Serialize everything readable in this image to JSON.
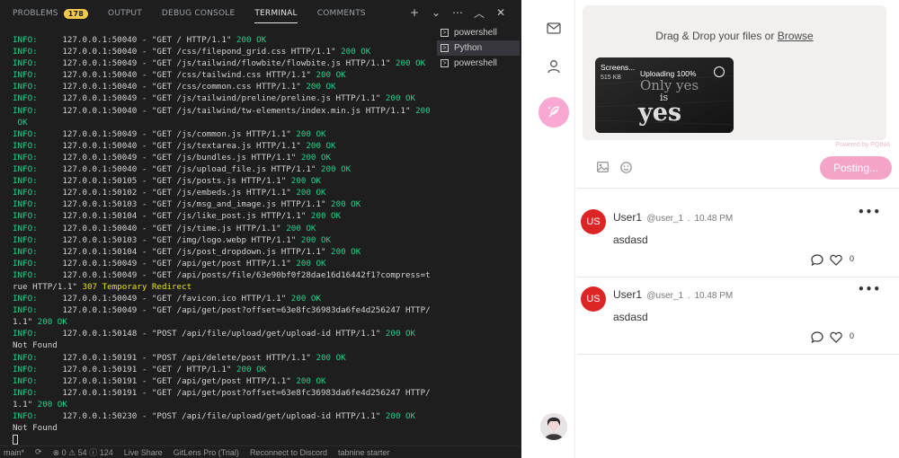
{
  "vscode": {
    "tabs": [
      {
        "label": "PROBLEMS",
        "badge": "178"
      },
      {
        "label": "OUTPUT"
      },
      {
        "label": "DEBUG CONSOLE"
      },
      {
        "label": "TERMINAL"
      },
      {
        "label": "COMMENTS"
      }
    ],
    "active_tab": "TERMINAL",
    "terminal_list": [
      {
        "label": "powershell"
      },
      {
        "label": "Python"
      },
      {
        "label": "powershell"
      }
    ],
    "active_terminal_index": 1,
    "log": [
      {
        "level": "INFO:",
        "text": "     127.0.0.1:50040 - \"GET / HTTP/1.1\" ",
        "status": "200 OK"
      },
      {
        "level": "INFO:",
        "text": "     127.0.0.1:50040 - \"GET /css/filepond_grid.css HTTP/1.1\" ",
        "status": "200 OK"
      },
      {
        "level": "INFO:",
        "text": "     127.0.0.1:50049 - \"GET /js/tailwind/flowbite/flowbite.js HTTP/1.1\" ",
        "status": "200 OK"
      },
      {
        "level": "INFO:",
        "text": "     127.0.0.1:50040 - \"GET /css/tailwind.css HTTP/1.1\" ",
        "status": "200 OK"
      },
      {
        "level": "INFO:",
        "text": "     127.0.0.1:50040 - \"GET /css/common.css HTTP/1.1\" ",
        "status": "200 OK"
      },
      {
        "level": "INFO:",
        "text": "     127.0.0.1:50049 - \"GET /js/tailwind/preline/preline.js HTTP/1.1\" ",
        "status": "200 OK"
      },
      {
        "level": "INFO:",
        "text": "     127.0.0.1:50040 - \"GET /js/tailwind/tw-elements/index.min.js HTTP/1.1\" ",
        "status": "200"
      },
      {
        "level": "",
        "text": " ",
        "status": "OK"
      },
      {
        "level": "INFO:",
        "text": "     127.0.0.1:50049 - \"GET /js/common.js HTTP/1.1\" ",
        "status": "200 OK"
      },
      {
        "level": "INFO:",
        "text": "     127.0.0.1:50040 - \"GET /js/textarea.js HTTP/1.1\" ",
        "status": "200 OK"
      },
      {
        "level": "INFO:",
        "text": "     127.0.0.1:50049 - \"GET /js/bundles.js HTTP/1.1\" ",
        "status": "200 OK"
      },
      {
        "level": "INFO:",
        "text": "     127.0.0.1:50040 - \"GET /js/upload_file.js HTTP/1.1\" ",
        "status": "200 OK"
      },
      {
        "level": "INFO:",
        "text": "     127.0.0.1:50105 - \"GET /js/posts.js HTTP/1.1\" ",
        "status": "200 OK"
      },
      {
        "level": "INFO:",
        "text": "     127.0.0.1:50102 - \"GET /js/embeds.js HTTP/1.1\" ",
        "status": "200 OK"
      },
      {
        "level": "INFO:",
        "text": "     127.0.0.1:50103 - \"GET /js/msg_and_image.js HTTP/1.1\" ",
        "status": "200 OK"
      },
      {
        "level": "INFO:",
        "text": "     127.0.0.1:50104 - \"GET /js/like_post.js HTTP/1.1\" ",
        "status": "200 OK"
      },
      {
        "level": "INFO:",
        "text": "     127.0.0.1:50040 - \"GET /js/time.js HTTP/1.1\" ",
        "status": "200 OK"
      },
      {
        "level": "INFO:",
        "text": "     127.0.0.1:50103 - \"GET /img/logo.webp HTTP/1.1\" ",
        "status": "200 OK"
      },
      {
        "level": "INFO:",
        "text": "     127.0.0.1:50104 - \"GET /js/post_dropdown.js HTTP/1.1\" ",
        "status": "200 OK"
      },
      {
        "level": "INFO:",
        "text": "     127.0.0.1:50049 - \"GET /api/get/post HTTP/1.1\" ",
        "status": "200 OK"
      },
      {
        "level": "INFO:",
        "text": "     127.0.0.1:50049 - \"GET /api/posts/file/63e90bf0f28dae16d16442f1?compress=t",
        "status": ""
      },
      {
        "level": "",
        "text": "rue HTTP/1.1\" ",
        "status": "307 Temporary Redirect",
        "redirect": true
      },
      {
        "level": "INFO:",
        "text": "     127.0.0.1:50049 - \"GET /favicon.ico HTTP/1.1\" ",
        "status": "200 OK"
      },
      {
        "level": "INFO:",
        "text": "     127.0.0.1:50049 - \"GET /api/get/post?offset=63e8fc36983da6fe4d256247 HTTP/",
        "status": ""
      },
      {
        "level": "",
        "text": "1.1\" ",
        "status": "200 OK"
      },
      {
        "level": "INFO:",
        "text": "     127.0.0.1:50148 - \"POST /api/file/upload/get/upload-id HTTP/1.1\" ",
        "status": "200 OK"
      },
      {
        "level": "",
        "text": "Not Found",
        "status": ""
      },
      {
        "level": "INFO:",
        "text": "     127.0.0.1:50191 - \"POST /api/delete/post HTTP/1.1\" ",
        "status": "200 OK"
      },
      {
        "level": "INFO:",
        "text": "     127.0.0.1:50191 - \"GET / HTTP/1.1\" ",
        "status": "200 OK"
      },
      {
        "level": "INFO:",
        "text": "     127.0.0.1:50191 - \"GET /api/get/post HTTP/1.1\" ",
        "status": "200 OK"
      },
      {
        "level": "INFO:",
        "text": "     127.0.0.1:50191 - \"GET /api/get/post?offset=63e8fc36983da6fe4d256247 HTTP/",
        "status": ""
      },
      {
        "level": "",
        "text": "1.1\" ",
        "status": "200 OK"
      },
      {
        "level": "INFO:",
        "text": "     127.0.0.1:50230 - \"POST /api/file/upload/get/upload-id HTTP/1.1\" ",
        "status": "200 OK"
      },
      {
        "level": "",
        "text": "Not Found",
        "status": ""
      }
    ],
    "statusbar": {
      "branch": "main*",
      "errors": "⊗ 0 ⚠ 54 ⓘ 124",
      "liveshare": "Live Share",
      "gitlens": "GitLens Pro (Trial)",
      "discord": "Reconnect to Discord",
      "tabnine": "tabnine starter"
    }
  },
  "app": {
    "dropzone": {
      "text": "Drag & Drop your files or ",
      "browse": "Browse"
    },
    "upload": {
      "filename": "Screens...",
      "size": "515 KB",
      "status": "Uploading 100%",
      "progress": 1.0
    },
    "upload_image_text": {
      "line1": "Only yes",
      "line2": "is",
      "line3": "yes"
    },
    "powered_by": "Powered by PQINA",
    "post_button": "Posting...",
    "posts": [
      {
        "initials": "US",
        "name": "User1",
        "handle": "@user_1",
        "time": "10.48 PM",
        "text": "asdasd",
        "likes": "0"
      },
      {
        "initials": "US",
        "name": "User1",
        "handle": "@user_1",
        "time": "10.48 PM",
        "text": "asdasd",
        "likes": "0"
      }
    ],
    "colors": {
      "accent": "#f9a8d4",
      "avatar": "#dc2626",
      "button": "#f4a4c6"
    }
  }
}
